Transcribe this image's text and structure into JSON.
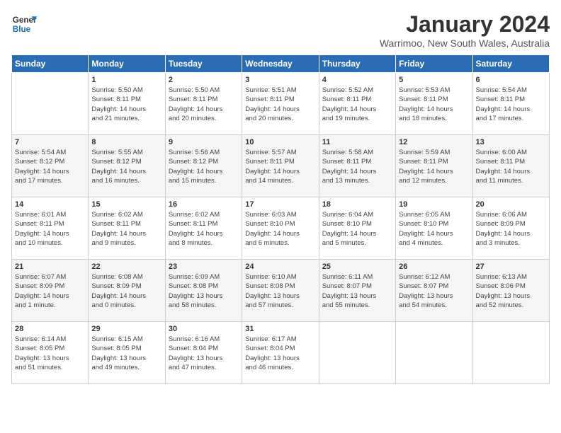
{
  "logo": {
    "line1": "General",
    "line2": "Blue"
  },
  "title": "January 2024",
  "subtitle": "Warrimoo, New South Wales, Australia",
  "days_of_week": [
    "Sunday",
    "Monday",
    "Tuesday",
    "Wednesday",
    "Thursday",
    "Friday",
    "Saturday"
  ],
  "weeks": [
    [
      {
        "num": "",
        "info": ""
      },
      {
        "num": "1",
        "info": "Sunrise: 5:50 AM\nSunset: 8:11 PM\nDaylight: 14 hours\nand 21 minutes."
      },
      {
        "num": "2",
        "info": "Sunrise: 5:50 AM\nSunset: 8:11 PM\nDaylight: 14 hours\nand 20 minutes."
      },
      {
        "num": "3",
        "info": "Sunrise: 5:51 AM\nSunset: 8:11 PM\nDaylight: 14 hours\nand 20 minutes."
      },
      {
        "num": "4",
        "info": "Sunrise: 5:52 AM\nSunset: 8:11 PM\nDaylight: 14 hours\nand 19 minutes."
      },
      {
        "num": "5",
        "info": "Sunrise: 5:53 AM\nSunset: 8:11 PM\nDaylight: 14 hours\nand 18 minutes."
      },
      {
        "num": "6",
        "info": "Sunrise: 5:54 AM\nSunset: 8:11 PM\nDaylight: 14 hours\nand 17 minutes."
      }
    ],
    [
      {
        "num": "7",
        "info": "Sunrise: 5:54 AM\nSunset: 8:12 PM\nDaylight: 14 hours\nand 17 minutes."
      },
      {
        "num": "8",
        "info": "Sunrise: 5:55 AM\nSunset: 8:12 PM\nDaylight: 14 hours\nand 16 minutes."
      },
      {
        "num": "9",
        "info": "Sunrise: 5:56 AM\nSunset: 8:12 PM\nDaylight: 14 hours\nand 15 minutes."
      },
      {
        "num": "10",
        "info": "Sunrise: 5:57 AM\nSunset: 8:11 PM\nDaylight: 14 hours\nand 14 minutes."
      },
      {
        "num": "11",
        "info": "Sunrise: 5:58 AM\nSunset: 8:11 PM\nDaylight: 14 hours\nand 13 minutes."
      },
      {
        "num": "12",
        "info": "Sunrise: 5:59 AM\nSunset: 8:11 PM\nDaylight: 14 hours\nand 12 minutes."
      },
      {
        "num": "13",
        "info": "Sunrise: 6:00 AM\nSunset: 8:11 PM\nDaylight: 14 hours\nand 11 minutes."
      }
    ],
    [
      {
        "num": "14",
        "info": "Sunrise: 6:01 AM\nSunset: 8:11 PM\nDaylight: 14 hours\nand 10 minutes."
      },
      {
        "num": "15",
        "info": "Sunrise: 6:02 AM\nSunset: 8:11 PM\nDaylight: 14 hours\nand 9 minutes."
      },
      {
        "num": "16",
        "info": "Sunrise: 6:02 AM\nSunset: 8:11 PM\nDaylight: 14 hours\nand 8 minutes."
      },
      {
        "num": "17",
        "info": "Sunrise: 6:03 AM\nSunset: 8:10 PM\nDaylight: 14 hours\nand 6 minutes."
      },
      {
        "num": "18",
        "info": "Sunrise: 6:04 AM\nSunset: 8:10 PM\nDaylight: 14 hours\nand 5 minutes."
      },
      {
        "num": "19",
        "info": "Sunrise: 6:05 AM\nSunset: 8:10 PM\nDaylight: 14 hours\nand 4 minutes."
      },
      {
        "num": "20",
        "info": "Sunrise: 6:06 AM\nSunset: 8:09 PM\nDaylight: 14 hours\nand 3 minutes."
      }
    ],
    [
      {
        "num": "21",
        "info": "Sunrise: 6:07 AM\nSunset: 8:09 PM\nDaylight: 14 hours\nand 1 minute."
      },
      {
        "num": "22",
        "info": "Sunrise: 6:08 AM\nSunset: 8:09 PM\nDaylight: 14 hours\nand 0 minutes."
      },
      {
        "num": "23",
        "info": "Sunrise: 6:09 AM\nSunset: 8:08 PM\nDaylight: 13 hours\nand 58 minutes."
      },
      {
        "num": "24",
        "info": "Sunrise: 6:10 AM\nSunset: 8:08 PM\nDaylight: 13 hours\nand 57 minutes."
      },
      {
        "num": "25",
        "info": "Sunrise: 6:11 AM\nSunset: 8:07 PM\nDaylight: 13 hours\nand 55 minutes."
      },
      {
        "num": "26",
        "info": "Sunrise: 6:12 AM\nSunset: 8:07 PM\nDaylight: 13 hours\nand 54 minutes."
      },
      {
        "num": "27",
        "info": "Sunrise: 6:13 AM\nSunset: 8:06 PM\nDaylight: 13 hours\nand 52 minutes."
      }
    ],
    [
      {
        "num": "28",
        "info": "Sunrise: 6:14 AM\nSunset: 8:05 PM\nDaylight: 13 hours\nand 51 minutes."
      },
      {
        "num": "29",
        "info": "Sunrise: 6:15 AM\nSunset: 8:05 PM\nDaylight: 13 hours\nand 49 minutes."
      },
      {
        "num": "30",
        "info": "Sunrise: 6:16 AM\nSunset: 8:04 PM\nDaylight: 13 hours\nand 47 minutes."
      },
      {
        "num": "31",
        "info": "Sunrise: 6:17 AM\nSunset: 8:04 PM\nDaylight: 13 hours\nand 46 minutes."
      },
      {
        "num": "",
        "info": ""
      },
      {
        "num": "",
        "info": ""
      },
      {
        "num": "",
        "info": ""
      }
    ]
  ]
}
